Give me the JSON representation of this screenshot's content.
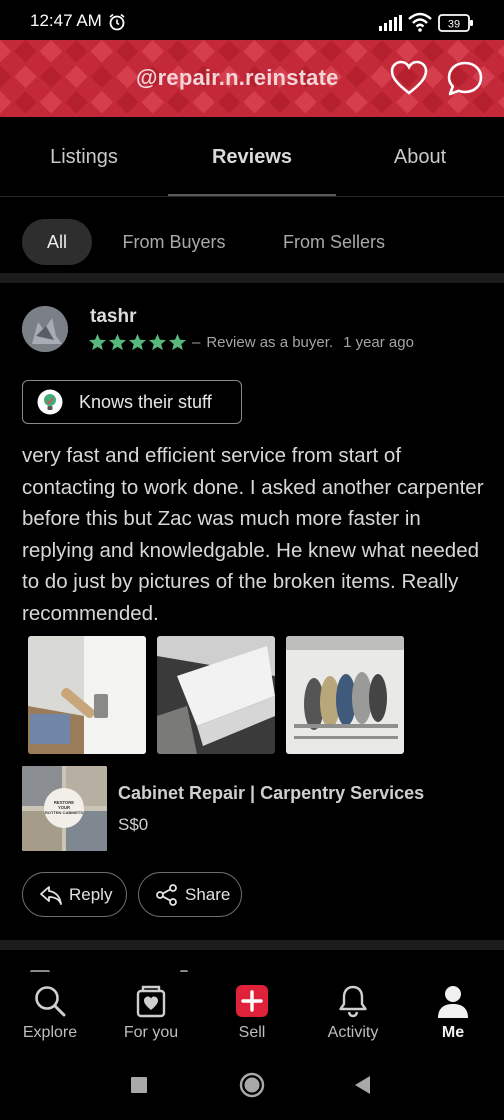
{
  "status_bar": {
    "time": "12:47 AM",
    "battery": "39"
  },
  "header": {
    "username": "@repair.n.reinstate",
    "icons": [
      "heart-icon",
      "chat-icon"
    ],
    "brand_color": "#c22a3a"
  },
  "tabs": [
    {
      "label": "Listings",
      "active": false
    },
    {
      "label": "Reviews",
      "active": true
    },
    {
      "label": "About",
      "active": false
    }
  ],
  "filters": [
    {
      "label": "All",
      "active": true
    },
    {
      "label": "From Buyers",
      "active": false
    },
    {
      "label": "From Sellers",
      "active": false
    }
  ],
  "review": {
    "reviewer": "tashr",
    "rating": 5,
    "role": "Review as a buyer.",
    "time": "1 year ago",
    "compliment": "Knows their stuff",
    "text": "very fast and efficient service from start of contacting to work done. I asked another carpenter before this but Zac was much more faster in replying and knowledgable. He knew what needed to do just by pictures of the broken items. Really recommended.",
    "photos": [
      "cabinet-hinge-photo",
      "drawer-photo",
      "dish-rack-photo"
    ],
    "listing": {
      "title": "Cabinet Repair | Carpentry Services",
      "price": "S$0",
      "thumbnail_text": "RESTORE YOUR ROTTEN CABINETS"
    },
    "actions": {
      "reply": "Reply",
      "share": "Share"
    }
  },
  "bottom_nav": [
    {
      "label": "Explore",
      "icon": "search-icon",
      "active": false
    },
    {
      "label": "For you",
      "icon": "for-you-icon",
      "active": false
    },
    {
      "label": "Sell",
      "icon": "sell-icon",
      "active": false
    },
    {
      "label": "Activity",
      "icon": "bell-icon",
      "active": false
    },
    {
      "label": "Me",
      "icon": "profile-icon",
      "active": true
    }
  ],
  "colors": {
    "star": "#58b77d",
    "accent": "#e0213a",
    "background": "#000000"
  }
}
